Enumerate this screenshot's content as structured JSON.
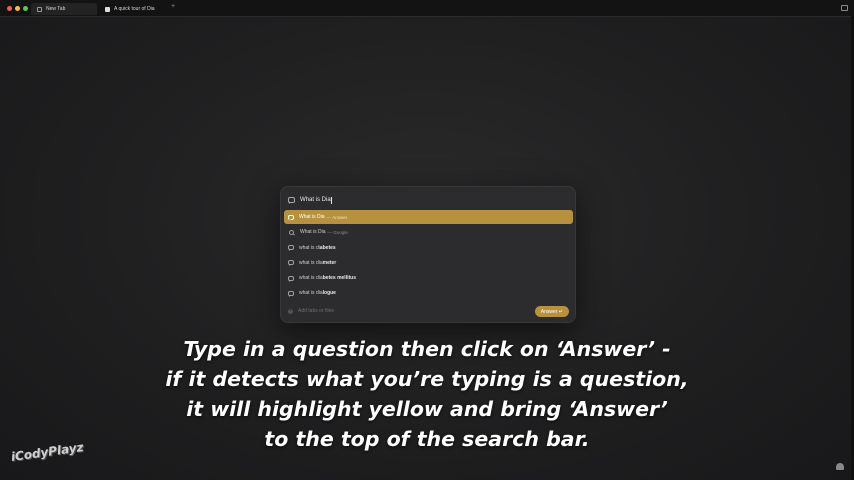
{
  "browser": {
    "tabs": [
      {
        "label": "New Tab",
        "active": true
      },
      {
        "label": "A quick tour of Dia",
        "active": false
      }
    ],
    "new_tab_symbol": "+"
  },
  "palette": {
    "query": "What is Dia",
    "results": [
      {
        "icon": "chat-icon",
        "prefix": "What is Dia",
        "bold": "",
        "suffix": "— Answer",
        "selected": true
      },
      {
        "icon": "search-icon",
        "prefix": "What is Dia",
        "bold": "",
        "suffix": "— Google",
        "selected": false
      },
      {
        "icon": "chat-icon",
        "prefix": "what is di",
        "bold": "abetes",
        "suffix": "",
        "selected": false
      },
      {
        "icon": "chat-icon",
        "prefix": "what is dia",
        "bold": "meter",
        "suffix": "",
        "selected": false
      },
      {
        "icon": "chat-icon",
        "prefix": "what is dia",
        "bold": "betes mellitus",
        "suffix": "",
        "selected": false
      },
      {
        "icon": "chat-icon",
        "prefix": "what is dia",
        "bold": "logue",
        "suffix": "",
        "selected": false
      }
    ],
    "footer_placeholder": "Add tabs or files",
    "answer_button": "Answer ↵"
  },
  "caption": {
    "lines": [
      "Type in a question then click on ‘Answer’ -",
      "if it detects what you’re typing is a question,",
      "it will highlight yellow and bring ‘Answer’",
      "to the top of the search bar."
    ]
  },
  "watermark": "iCodyPlayz",
  "colors": {
    "accent": "#b8913f",
    "background": "#1f1f20",
    "palette_bg": "#2c2c2e"
  }
}
